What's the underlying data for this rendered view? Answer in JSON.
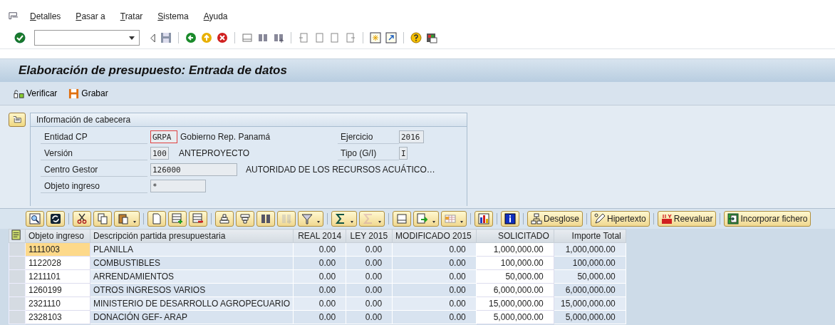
{
  "menu": [
    {
      "label": "Detalles"
    },
    {
      "label": "Pasar a"
    },
    {
      "label": "Tratar"
    },
    {
      "label": "Sistema"
    },
    {
      "label": "Ayuda"
    }
  ],
  "window": {
    "title": "Elaboración de presupuesto: Entrada de datos"
  },
  "app_toolbar": [
    {
      "label": "Verificar"
    },
    {
      "label": "Grabar"
    }
  ],
  "header_info": {
    "title": "Información de cabecera",
    "rows": [
      {
        "label": "Entidad CP",
        "value": "GRPA",
        "focused": true,
        "text": "Gobierno Rep. Panamá",
        "right": {
          "label": "Ejercicio",
          "value": "2016"
        }
      },
      {
        "label": "Versión",
        "value": "100",
        "focused": false,
        "text": "ANTEPROYECTO",
        "right": {
          "label": "Tipo (G/I)",
          "value": "I"
        }
      },
      {
        "label": "Centro Gestor",
        "value": "126000",
        "focused": false,
        "text": "AUTORIDAD DE LOS RECURSOS ACUÁTICO…"
      },
      {
        "label": "Objeto ingreso",
        "value": "*",
        "focused": false
      }
    ]
  },
  "alv_toolbar": [
    [
      {
        "kind": "icon",
        "menu": false,
        "disabled": false
      },
      {
        "kind": "icon",
        "menu": false,
        "disabled": false
      }
    ],
    [
      {
        "kind": "icon",
        "menu": false,
        "disabled": false
      },
      {
        "kind": "icon",
        "menu": false,
        "disabled": false
      },
      {
        "kind": "icon",
        "menu": true,
        "disabled": false
      }
    ],
    [
      {
        "kind": "icon",
        "menu": false,
        "disabled": false
      },
      {
        "kind": "icon",
        "menu": false,
        "disabled": false
      },
      {
        "kind": "icon",
        "menu": false,
        "disabled": false
      }
    ],
    [
      {
        "kind": "icon",
        "menu": false,
        "disabled": false
      },
      {
        "kind": "icon",
        "menu": false,
        "disabled": false
      },
      {
        "kind": "icon",
        "menu": false,
        "disabled": false
      },
      {
        "kind": "icon",
        "menu": false,
        "disabled": true
      },
      {
        "kind": "icon",
        "menu": true,
        "disabled": false
      }
    ],
    [
      {
        "kind": "icon",
        "menu": true,
        "disabled": false
      },
      {
        "kind": "icon",
        "menu": true,
        "disabled": true
      }
    ],
    [
      {
        "kind": "icon",
        "menu": false,
        "disabled": false
      },
      {
        "kind": "icon",
        "menu": true,
        "disabled": false
      },
      {
        "kind": "icon",
        "menu": true,
        "disabled": false
      }
    ],
    [
      {
        "kind": "icon",
        "menu": false,
        "disabled": false
      }
    ],
    [
      {
        "kind": "icon",
        "menu": false,
        "disabled": false
      }
    ],
    [
      {
        "kind": "text",
        "label": "Desglose",
        "menu": false,
        "disabled": false
      }
    ],
    [
      {
        "kind": "text",
        "label": "Hipertexto",
        "menu": false,
        "disabled": false
      }
    ],
    [
      {
        "kind": "text",
        "label": "Reevaluar",
        "menu": false,
        "disabled": false
      }
    ],
    [
      {
        "kind": "text",
        "label": "Incorporar fichero",
        "menu": false,
        "disabled": false
      }
    ]
  ],
  "table": {
    "columns": [
      "Objeto ingreso",
      "Descripción partida presupuestaria",
      "REAL 2014",
      "LEY 2015",
      "MODIFICADO 2015",
      "SOLICITADO",
      "Importe Total"
    ],
    "rows": [
      {
        "selected": true,
        "cells": [
          "1111003",
          "PLANILLA",
          "0.00",
          "0.00",
          "0.00",
          "1,000,000.00",
          "1,000,000.00"
        ]
      },
      {
        "selected": false,
        "cells": [
          "1122028",
          "COMBUSTIBLES",
          "0.00",
          "0.00",
          "0.00",
          "100,000.00",
          "100,000.00"
        ]
      },
      {
        "selected": false,
        "cells": [
          "1211101",
          "ARRENDAMIENTOS",
          "0.00",
          "0.00",
          "0.00",
          "50,000.00",
          "50,000.00"
        ]
      },
      {
        "selected": false,
        "cells": [
          "1260199",
          "OTROS INGRESOS VARIOS",
          "0.00",
          "0.00",
          "0.00",
          "6,000,000.00",
          "6,000,000.00"
        ]
      },
      {
        "selected": false,
        "cells": [
          "2321110",
          "MINISTERIO DE DESARROLLO AGROPECUARIO",
          "0.00",
          "0.00",
          "0.00",
          "15,000,000.00",
          "15,000,000.00"
        ]
      },
      {
        "selected": false,
        "cells": [
          "2328103",
          "DONACIÓN GEF- ARAP",
          "0.00",
          "0.00",
          "0.00",
          "5,000,000.00",
          "5,000,000.00"
        ]
      }
    ]
  }
}
